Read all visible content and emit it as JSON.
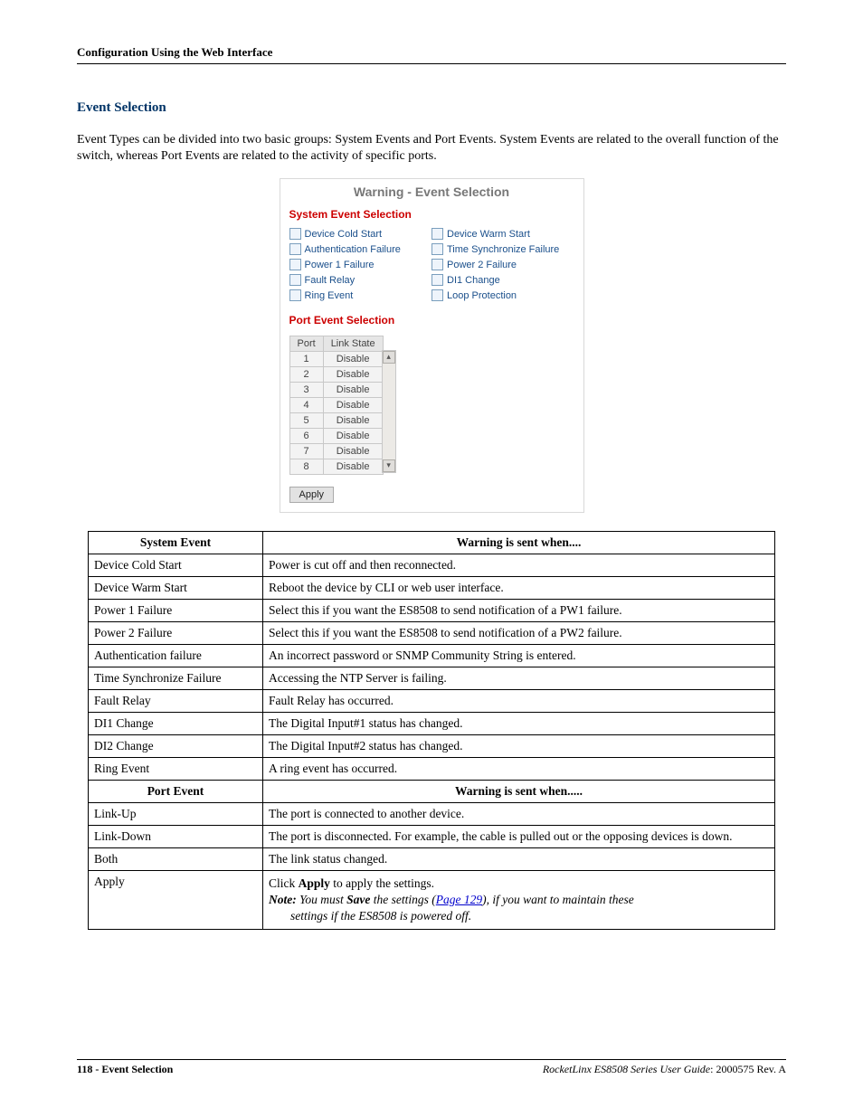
{
  "running_head": "Configuration Using the Web Interface",
  "section_title": "Event Selection",
  "intro": "Event Types can be divided into two basic groups: System Events and Port Events. System Events are related to the overall function of the switch, whereas Port Events are related to the activity of specific ports.",
  "panel": {
    "title": "Warning - Event Selection",
    "system_title": "System Event Selection",
    "checks": [
      [
        "Device Cold Start",
        "Device Warm Start"
      ],
      [
        "Authentication Failure",
        "Time Synchronize Failure"
      ],
      [
        "Power 1 Failure",
        "Power 2 Failure"
      ],
      [
        "Fault Relay",
        "DI1 Change"
      ],
      [
        "Ring Event",
        "Loop Protection"
      ]
    ],
    "port_title": "Port Event Selection",
    "port_header": [
      "Port",
      "Link State"
    ],
    "port_rows": [
      [
        "1",
        "Disable"
      ],
      [
        "2",
        "Disable"
      ],
      [
        "3",
        "Disable"
      ],
      [
        "4",
        "Disable"
      ],
      [
        "5",
        "Disable"
      ],
      [
        "6",
        "Disable"
      ],
      [
        "7",
        "Disable"
      ],
      [
        "8",
        "Disable"
      ]
    ],
    "apply_label": "Apply"
  },
  "table": {
    "sys_header": [
      "System Event",
      "Warning is sent when...."
    ],
    "sys_rows": [
      [
        "Device Cold Start",
        "Power is cut off and then reconnected."
      ],
      [
        "Device Warm Start",
        "Reboot the device by CLI or web user interface."
      ],
      [
        "Power 1 Failure",
        "Select this if you want the ES8508 to send notification of a PW1 failure."
      ],
      [
        "Power 2 Failure",
        "Select this if you want the ES8508 to send notification of a PW2 failure."
      ],
      [
        "Authentication failure",
        "An incorrect password or SNMP Community String is entered."
      ],
      [
        "Time Synchronize Failure",
        "Accessing the NTP Server is failing."
      ],
      [
        "Fault Relay",
        "Fault Relay has occurred."
      ],
      [
        "DI1 Change",
        "The Digital Input#1 status has changed."
      ],
      [
        "DI2 Change",
        "The Digital Input#2 status has changed."
      ],
      [
        "Ring Event",
        "A ring event has occurred."
      ]
    ],
    "port_header": [
      "Port Event",
      "Warning is sent when....."
    ],
    "port_rows": [
      [
        "Link-Up",
        "The port is connected to another device."
      ],
      [
        "Link-Down",
        "The port is disconnected. For example, the cable is pulled out or the opposing devices is down."
      ],
      [
        "Both",
        "The link status changed."
      ]
    ],
    "apply_row_label": "Apply",
    "apply_click": "Click ",
    "apply_bold": "Apply",
    "apply_click_tail": " to apply the settings.",
    "note_lead": "Note:",
    "note_mid1": "  You must ",
    "note_save": "Save",
    "note_mid2": " the settings (",
    "note_link": "Page 129",
    "note_tail1": "), if you want to maintain these",
    "note_line2": "settings if the ES8508 is powered off."
  },
  "footer": {
    "left_page": "118 - Event Selection",
    "right1": "RocketLinx ES8508 Series  User Guide",
    "right2": ": 2000575 Rev. A"
  }
}
